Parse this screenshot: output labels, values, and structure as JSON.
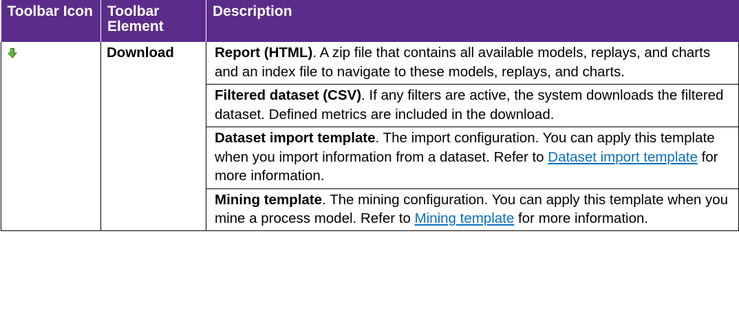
{
  "table": {
    "headers": [
      "Toolbar Icon",
      "Toolbar Element",
      "Description"
    ],
    "header_background": "#5b2c8a",
    "rows": [
      {
        "icon": "download-arrow-icon",
        "element": "Download",
        "descriptions": [
          {
            "term": "Report (HTML)",
            "text": ". A zip file that contains all available models, replays, and charts and an index file to navigate to these models, replays, and charts."
          },
          {
            "term": "Filtered dataset (CSV)",
            "text": ". If any filters are active, the system downloads the filtered dataset. Defined metrics are included in the download."
          },
          {
            "term": "Dataset import template",
            "text": ". The import configuration. You can apply this template when you import information from a dataset. Refer to ",
            "link": "Dataset import template",
            "after": " for more information."
          },
          {
            "term": "Mining template",
            "text": ". The mining configuration. You can apply this template when you mine a process model. Refer to ",
            "link": "Mining template",
            "after": " for more information."
          }
        ]
      }
    ]
  },
  "colors": {
    "link": "#0a6fc2",
    "icon_green": "#4caf2a"
  }
}
